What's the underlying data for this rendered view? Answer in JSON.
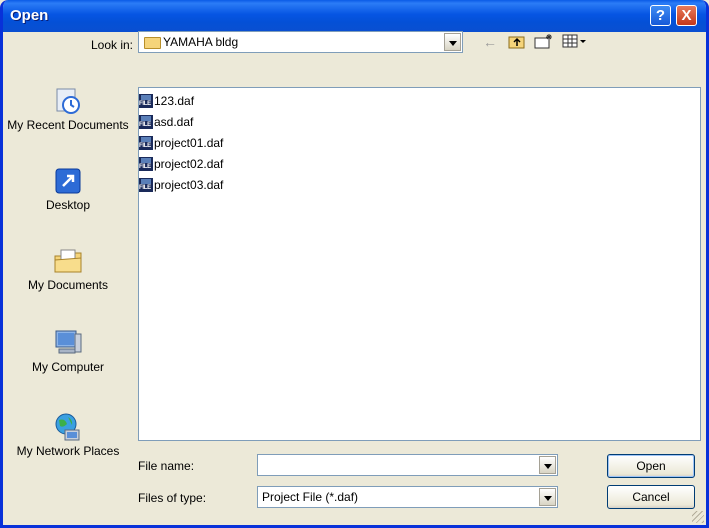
{
  "window": {
    "title": "Open",
    "help_label": "?",
    "close_label": "X"
  },
  "lookin": {
    "label": "Look in:",
    "value": "YAMAHA bldg"
  },
  "toolbar": {
    "back_glyph": "←",
    "up_glyph": "⮤",
    "newfolder_glyph": "✶",
    "views_glyph": "▦▾"
  },
  "places": [
    {
      "label": "My Recent Documents",
      "icon": "recent-documents-icon"
    },
    {
      "label": "Desktop",
      "icon": "desktop-icon"
    },
    {
      "label": "My Documents",
      "icon": "my-documents-icon"
    },
    {
      "label": "My Computer",
      "icon": "my-computer-icon"
    },
    {
      "label": "My Network Places",
      "icon": "network-places-icon"
    }
  ],
  "files": [
    {
      "name": "123.daf"
    },
    {
      "name": "asd.daf"
    },
    {
      "name": "project01.daf"
    },
    {
      "name": "project02.daf"
    },
    {
      "name": "project03.daf"
    }
  ],
  "form": {
    "filename_label": "File name:",
    "filename_value": "",
    "filetype_label": "Files of type:",
    "filetype_value": "Project File (*.daf)"
  },
  "buttons": {
    "open": "Open",
    "cancel": "Cancel"
  }
}
